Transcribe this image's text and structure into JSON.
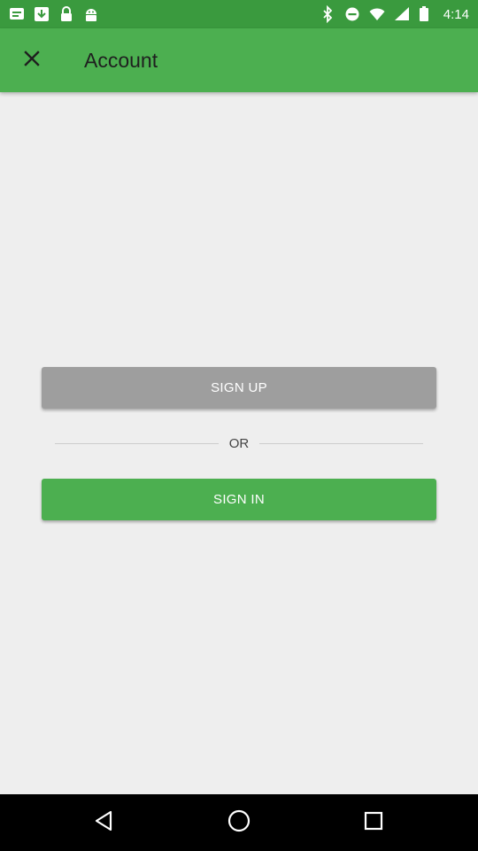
{
  "status_bar": {
    "time": "4:14",
    "left_icons": [
      "notification-icon",
      "download-icon",
      "lock-icon",
      "android-icon"
    ],
    "right_icons": [
      "bluetooth-icon",
      "do-not-disturb-icon",
      "wifi-icon",
      "signal-icon",
      "battery-icon"
    ]
  },
  "app_bar": {
    "title": "Account",
    "close_icon": "close-icon",
    "color": "#4caf50"
  },
  "actions": {
    "sign_up_label": "SIGN UP",
    "or_label": "OR",
    "sign_in_label": "SIGN IN",
    "sign_up_color": "#9e9e9e",
    "sign_in_color": "#4caf50"
  },
  "nav_bar": {
    "icons": [
      "back-icon",
      "home-icon",
      "recent-apps-icon"
    ]
  }
}
